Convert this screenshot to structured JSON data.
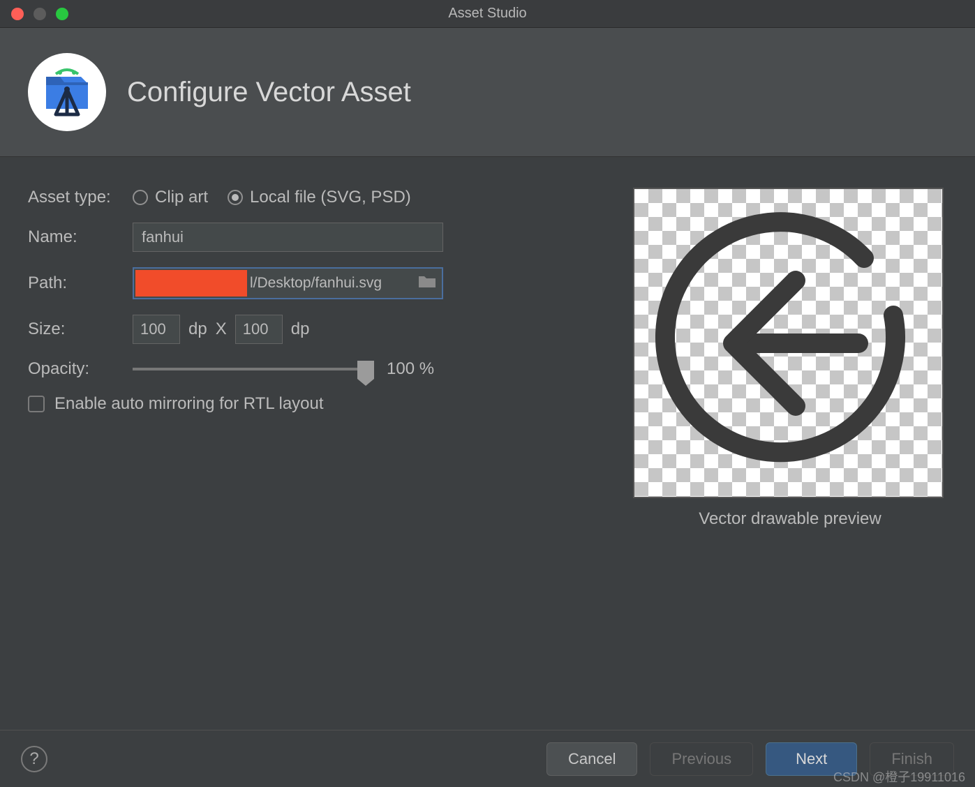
{
  "window": {
    "title": "Asset Studio"
  },
  "banner": {
    "heading": "Configure Vector Asset"
  },
  "form": {
    "asset_type_label": "Asset type:",
    "radio_clip_art": "Clip art",
    "radio_local_file": "Local file (SVG, PSD)",
    "name_label": "Name:",
    "name_value": "fanhui",
    "path_label": "Path:",
    "path_visible": "l/Desktop/fanhui.svg",
    "size_label": "Size:",
    "size_w": "100",
    "size_h": "100",
    "size_unit": "dp",
    "size_sep": "X",
    "opacity_label": "Opacity:",
    "opacity_value": "100 %",
    "auto_mirror_label": "Enable auto mirroring for RTL layout"
  },
  "preview": {
    "caption": "Vector drawable preview"
  },
  "footer": {
    "cancel": "Cancel",
    "previous": "Previous",
    "next": "Next",
    "finish": "Finish"
  },
  "watermark": "CSDN @橙子19911016"
}
